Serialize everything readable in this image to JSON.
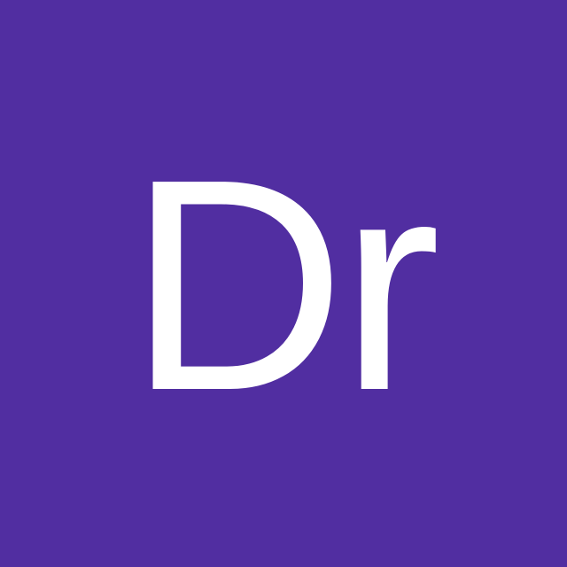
{
  "avatar": {
    "initials": "Dr",
    "background_color": "#512ea1",
    "text_color": "#ffffff"
  }
}
